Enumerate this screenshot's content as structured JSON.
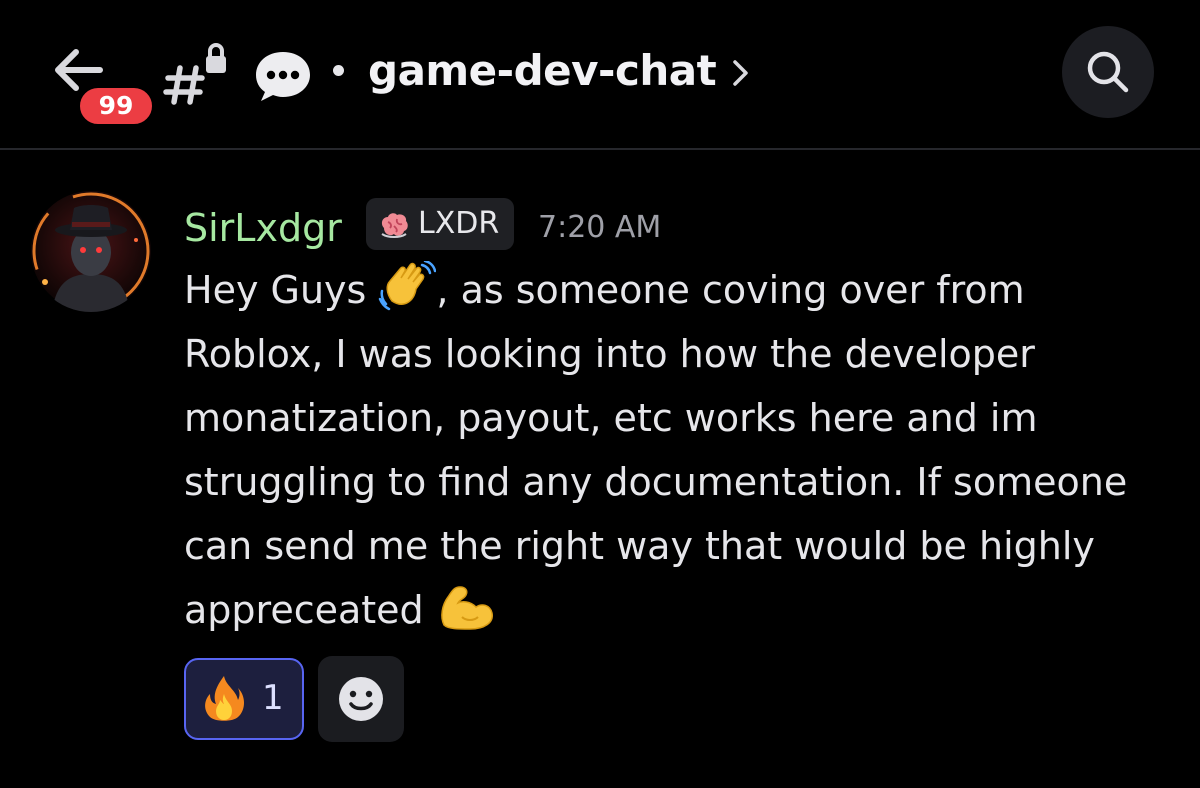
{
  "header": {
    "unread_count": "99",
    "channel_name": "game-dev-chat"
  },
  "message": {
    "author": "SirLxdgr",
    "role_tag": "LXDR",
    "timestamp": "7:20 AM",
    "lines": [
      {
        "before": "Hey Guys ",
        "emoji": "waving-hand",
        "after": ", as someone coving over from"
      },
      {
        "text": "Roblox, I was looking into how the developer"
      },
      {
        "text": "monatization, payout, etc works here and im"
      },
      {
        "text": "struggling to find any documentation. If someone"
      },
      {
        "text": "can send me the right way that would be highly"
      },
      {
        "before": "appreceated ",
        "emoji": "flexed-biceps",
        "after": ""
      }
    ],
    "reactions": [
      {
        "emoji": "fire",
        "count": "1",
        "selected": true
      }
    ]
  },
  "colors": {
    "background": "#000000",
    "username": "#a6e8a1",
    "badge": "#ec3d43",
    "reaction_border": "#5865f2"
  }
}
